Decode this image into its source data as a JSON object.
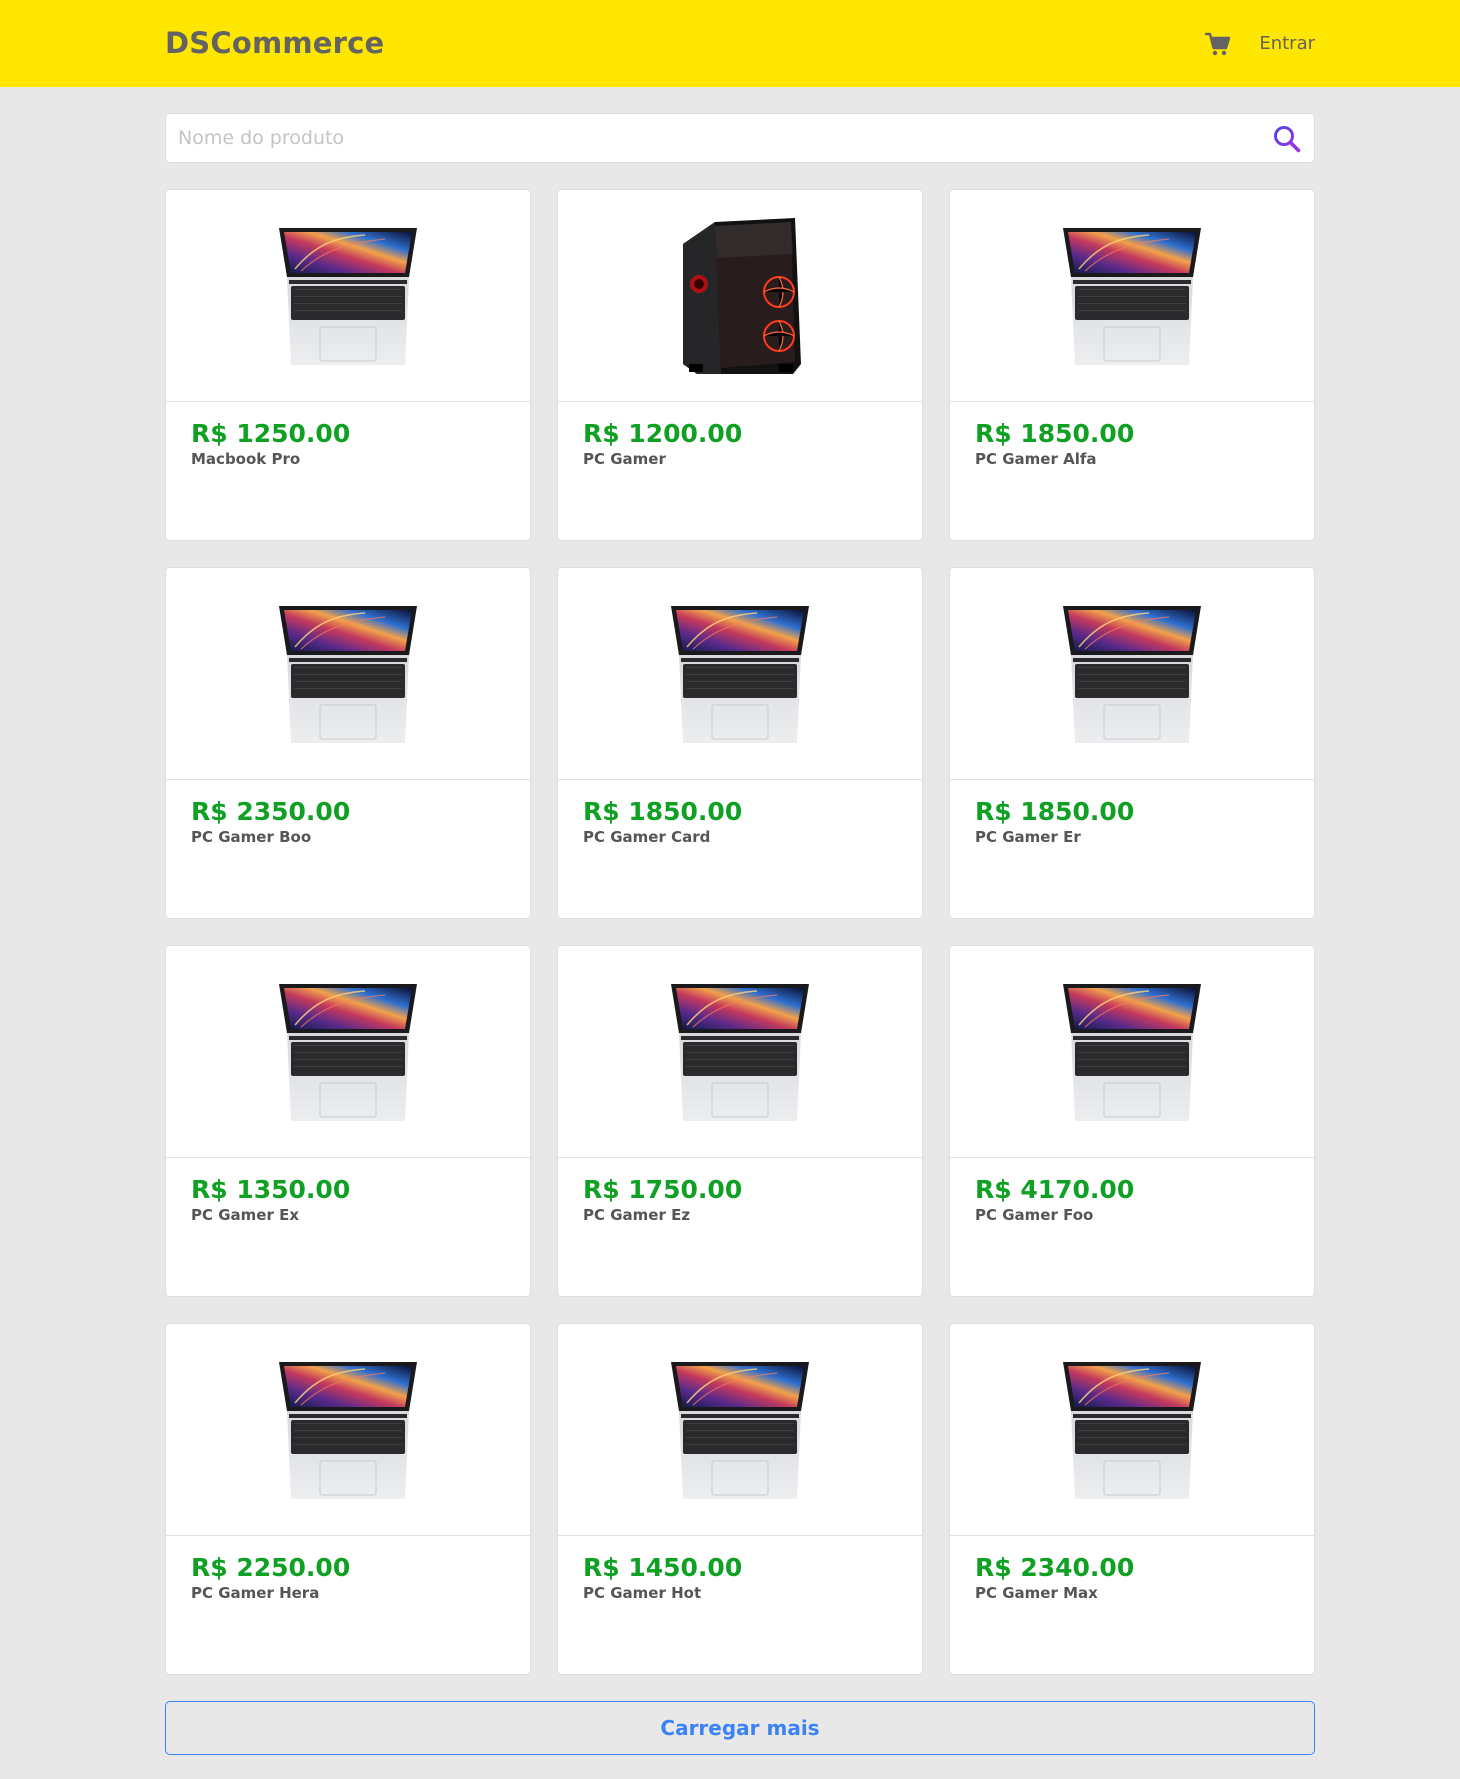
{
  "header": {
    "logo": "DSCommerce",
    "cart_icon": "cart-icon",
    "login_label": "Entrar",
    "background": "#ffe600"
  },
  "search": {
    "placeholder": "Nome do produto",
    "value": "",
    "icon": "search-icon",
    "icon_color": "#6d28d9"
  },
  "products": [
    {
      "price": "R$ 1250.00",
      "name": "Macbook Pro",
      "image": "laptop"
    },
    {
      "price": "R$ 1200.00",
      "name": "PC Gamer",
      "image": "tower"
    },
    {
      "price": "R$ 1850.00",
      "name": "PC Gamer Alfa",
      "image": "laptop"
    },
    {
      "price": "R$ 2350.00",
      "name": "PC Gamer Boo",
      "image": "laptop"
    },
    {
      "price": "R$ 1850.00",
      "name": "PC Gamer Card",
      "image": "laptop"
    },
    {
      "price": "R$ 1850.00",
      "name": "PC Gamer Er",
      "image": "laptop"
    },
    {
      "price": "R$ 1350.00",
      "name": "PC Gamer Ex",
      "image": "laptop"
    },
    {
      "price": "R$ 1750.00",
      "name": "PC Gamer Ez",
      "image": "laptop"
    },
    {
      "price": "R$ 4170.00",
      "name": "PC Gamer Foo",
      "image": "laptop"
    },
    {
      "price": "R$ 2250.00",
      "name": "PC Gamer Hera",
      "image": "laptop"
    },
    {
      "price": "R$ 1450.00",
      "name": "PC Gamer Hot",
      "image": "laptop"
    },
    {
      "price": "R$ 2340.00",
      "name": "PC Gamer Max",
      "image": "laptop"
    }
  ],
  "load_more_label": "Carregar mais",
  "colors": {
    "price": "#0fa024",
    "accent": "#3b82f6",
    "page_background": "#e8e8e9"
  }
}
